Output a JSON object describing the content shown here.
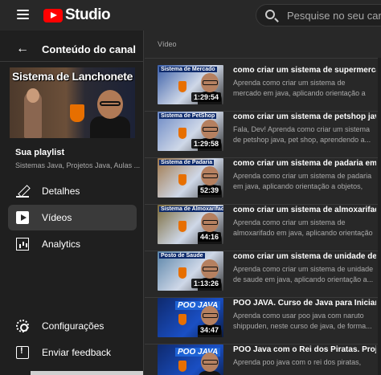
{
  "header": {
    "logo_text": "Studio",
    "search_placeholder": "Pesquise no seu canal"
  },
  "sidebar": {
    "back_title": "Conteúdo do canal",
    "playlist_thumb_title": "Sistema de Lanchonete",
    "playlist_label": "Sua playlist",
    "playlist_desc": "Sistemas Java, Projetos Java, Aulas ...",
    "nav": [
      {
        "label": "Detalhes",
        "icon": "pencil-icon"
      },
      {
        "label": "Vídeos",
        "icon": "videos-icon",
        "active": true
      },
      {
        "label": "Analytics",
        "icon": "analytics-icon"
      }
    ],
    "footer": [
      {
        "label": "Configurações",
        "icon": "gear-icon"
      },
      {
        "label": "Enviar feedback",
        "icon": "feedback-icon"
      }
    ]
  },
  "main": {
    "column_header": "Vídeo",
    "videos": [
      {
        "thumb_title": "Sistema de Mercado",
        "thumb_bg": "#3b5fa8",
        "duration": "1:29:54",
        "title": "como criar um sistema de supermercad...",
        "description": "Aprenda como criar um sistema de mercado em java, aplicando orientação a objetos, o..."
      },
      {
        "thumb_title": "Sistema de PetShop",
        "thumb_bg": "#6b88c4",
        "duration": "1:29:58",
        "title": "como criar um sistema de petshop java?...",
        "description": "Fala, Dev! Aprenda como criar um sistema de petshop java, pet shop, aprendendo a..."
      },
      {
        "thumb_title": "Sistema de Padaria",
        "thumb_bg": "#a0784a",
        "duration": "52:39",
        "title": "como criar um sistema de padaria em ja...",
        "description": "Aprenda como criar um sistema de padaria em java, aplicando orientação a objetos, o..."
      },
      {
        "thumb_title": "Sistema de Almoxarifado",
        "thumb_bg": "#7a6a3a",
        "duration": "44:16",
        "title": "como criar um sistema de almoxarifado ...",
        "description": "Aprenda como criar um sistema de almoxarifado em java, aplicando orientação a..."
      },
      {
        "thumb_title": "Posto de Saude",
        "thumb_bg": "#5a84a8",
        "duration": "1:13:26",
        "title": "como criar um sistema de unidade de s...",
        "description": "Aprenda como criar um sistema de unidade de saude em java, aplicando orientação a..."
      },
      {
        "thumb_title": "POO JAVA",
        "thumb_bg": "#0f2a6e",
        "duration": "34:47",
        "title": "POO JAVA. Curso de Java para Iniciante...",
        "description": "Aprenda como usar poo java com naruto shippuden, neste curso de java, de forma..."
      },
      {
        "thumb_title": "POO JAVA",
        "thumb_bg": "#0f2a6e",
        "duration": "",
        "title": "POO Java com o Rei dos Piratas. Projeto...",
        "description": "Aprenda poo java com o rei dos piratas,"
      }
    ]
  },
  "colors": {
    "brand_red": "#ff0000",
    "sidebar_bg": "#1f1f1f",
    "main_bg": "#282828",
    "active_nav": "#3a3a3a"
  }
}
